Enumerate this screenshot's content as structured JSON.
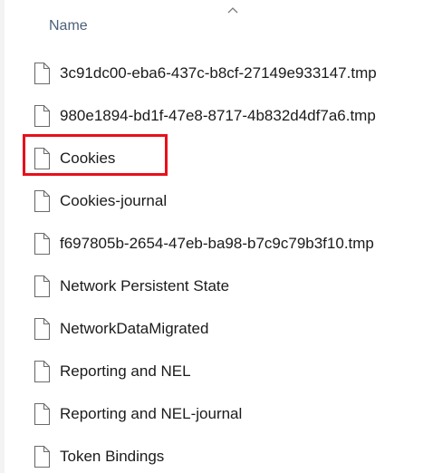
{
  "header": {
    "column_name": "Name",
    "sort_icon": "chevron-up-icon"
  },
  "files": [
    {
      "name": "3c91dc00-eba6-437c-b8cf-27149e933147.tmp",
      "icon": "file-icon"
    },
    {
      "name": "980e1894-bd1f-47e8-8717-4b832d4df7a6.tmp",
      "icon": "file-icon"
    },
    {
      "name": "Cookies",
      "icon": "file-icon",
      "highlighted": true
    },
    {
      "name": "Cookies-journal",
      "icon": "file-icon"
    },
    {
      "name": "f697805b-2654-47eb-ba98-b7c9c79b3f10.tmp",
      "icon": "file-icon"
    },
    {
      "name": "Network Persistent State",
      "icon": "file-icon"
    },
    {
      "name": "NetworkDataMigrated",
      "icon": "file-icon"
    },
    {
      "name": "Reporting and NEL",
      "icon": "file-icon"
    },
    {
      "name": "Reporting and NEL-journal",
      "icon": "file-icon"
    },
    {
      "name": "Token Bindings",
      "icon": "file-icon"
    }
  ],
  "colors": {
    "highlight_border": "#e8101a",
    "header_text": "#4c607a"
  }
}
